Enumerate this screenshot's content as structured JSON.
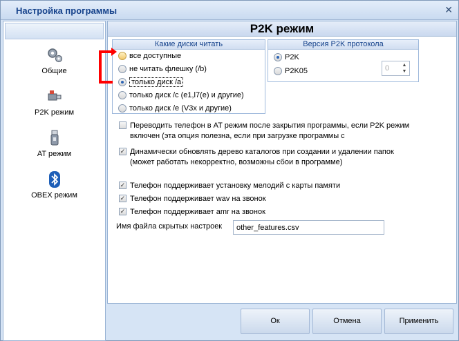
{
  "window": {
    "title": "Настройка программы"
  },
  "sidebar": {
    "items": [
      {
        "label": "Общие",
        "icon": "gears-icon"
      },
      {
        "label": "P2K режим",
        "icon": "connector-icon"
      },
      {
        "label": "AT режим",
        "icon": "usb-stick-icon"
      },
      {
        "label": "OBEX режим",
        "icon": "bluetooth-icon"
      }
    ]
  },
  "main": {
    "title": "P2K режим",
    "disks": {
      "title": "Какие диски читать",
      "options": [
        "все доступные",
        "не читать флешку (/b)",
        "только диск /a",
        "только диск /c (e1,l7(e) и другие)",
        "только диск /e (V3x и другие)"
      ],
      "selected_index": 2
    },
    "protocol": {
      "title": "Версия P2K протокола",
      "options": [
        "P2K",
        "P2K05"
      ],
      "selected_index": 0,
      "spin_value": "0"
    },
    "checks": [
      {
        "label": "Переводить телефон в AT режим после закрытия программы, если P2K режим включен (эта опция полезна, если при загрузке программы с",
        "checked": false
      },
      {
        "label": "Динамически обновлять дерево каталогов при создании и удалении папок (может работать некорректно, возможны сбои в программе)",
        "checked": true
      },
      {
        "label": "Телефон поддерживает установку мелодий с карты памяти",
        "checked": true
      },
      {
        "label": "Телефон поддерживает wav на звонок",
        "checked": true
      },
      {
        "label": "Телефон поддерживает amr на звонок",
        "checked": true
      }
    ],
    "hidden_settings": {
      "label": "Имя файла скрытых настроек",
      "value": "other_features.csv"
    }
  },
  "footer": {
    "ok_label": "Ок",
    "cancel_label": "Отмена",
    "apply_label": "Применить"
  },
  "colors": {
    "accent_title": "#15428b",
    "annotation_red": "#ff0000"
  }
}
